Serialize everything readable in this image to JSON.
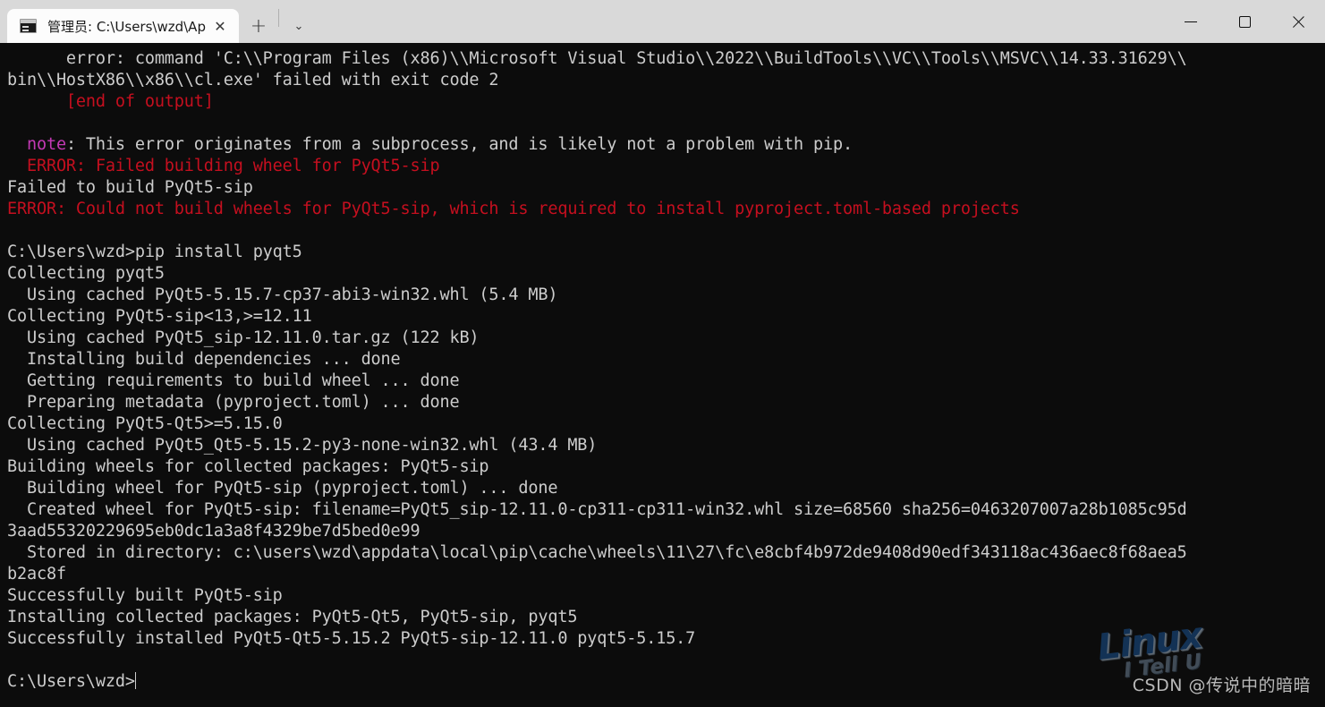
{
  "window": {
    "tab": {
      "title": "管理员: C:\\Users\\wzd\\AppDat",
      "icon": "console-icon",
      "close_label": "✕"
    },
    "new_tab_label": "+",
    "tab_menu_label": "⌄",
    "controls": {
      "minimize_label": "Minimize",
      "maximize_label": "Maximize",
      "close_label": "Close"
    }
  },
  "terminal": {
    "background": "#0c0c0c",
    "foreground": "#cccccc",
    "colors": {
      "white": "#cccccc",
      "red": "#c50f1f",
      "bright_red": "#e74856",
      "magenta": "#c239b3"
    },
    "prompt": "C:\\Users\\wzd>",
    "cursor": "|",
    "lines": [
      {
        "segments": [
          {
            "text": "      error: command 'C:\\\\Program Files (x86)\\\\Microsoft Visual Studio\\\\2022\\\\BuildTools\\\\VC\\\\Tools\\\\MSVC\\\\14.33.31629\\\\",
            "color": "white"
          }
        ]
      },
      {
        "segments": [
          {
            "text": "bin\\\\HostX86\\\\x86\\\\cl.exe' failed with exit code 2",
            "color": "white"
          }
        ]
      },
      {
        "segments": [
          {
            "text": "      [end of output]",
            "color": "red"
          }
        ]
      },
      {
        "segments": [
          {
            "text": "",
            "color": "white"
          }
        ]
      },
      {
        "segments": [
          {
            "text": "  note",
            "color": "magenta"
          },
          {
            "text": ": This error originates from a subprocess, and is likely not a problem with pip.",
            "color": "white"
          }
        ]
      },
      {
        "segments": [
          {
            "text": "  ERROR: Failed building wheel for PyQt5-sip",
            "color": "red"
          }
        ]
      },
      {
        "segments": [
          {
            "text": "Failed to build PyQt5-sip",
            "color": "white"
          }
        ]
      },
      {
        "segments": [
          {
            "text": "ERROR: Could not build wheels for PyQt5-sip, which is required to install pyproject.toml-based projects",
            "color": "red"
          }
        ]
      },
      {
        "segments": [
          {
            "text": "",
            "color": "white"
          }
        ]
      },
      {
        "segments": [
          {
            "text": "C:\\Users\\wzd>pip install pyqt5",
            "color": "white"
          }
        ]
      },
      {
        "segments": [
          {
            "text": "Collecting pyqt5",
            "color": "white"
          }
        ]
      },
      {
        "segments": [
          {
            "text": "  Using cached PyQt5-5.15.7-cp37-abi3-win32.whl (5.4 MB)",
            "color": "white"
          }
        ]
      },
      {
        "segments": [
          {
            "text": "Collecting PyQt5-sip<13,>=12.11",
            "color": "white"
          }
        ]
      },
      {
        "segments": [
          {
            "text": "  Using cached PyQt5_sip-12.11.0.tar.gz (122 kB)",
            "color": "white"
          }
        ]
      },
      {
        "segments": [
          {
            "text": "  Installing build dependencies ... done",
            "color": "white"
          }
        ]
      },
      {
        "segments": [
          {
            "text": "  Getting requirements to build wheel ... done",
            "color": "white"
          }
        ]
      },
      {
        "segments": [
          {
            "text": "  Preparing metadata (pyproject.toml) ... done",
            "color": "white"
          }
        ]
      },
      {
        "segments": [
          {
            "text": "Collecting PyQt5-Qt5>=5.15.0",
            "color": "white"
          }
        ]
      },
      {
        "segments": [
          {
            "text": "  Using cached PyQt5_Qt5-5.15.2-py3-none-win32.whl (43.4 MB)",
            "color": "white"
          }
        ]
      },
      {
        "segments": [
          {
            "text": "Building wheels for collected packages: PyQt5-sip",
            "color": "white"
          }
        ]
      },
      {
        "segments": [
          {
            "text": "  Building wheel for PyQt5-sip (pyproject.toml) ... done",
            "color": "white"
          }
        ]
      },
      {
        "segments": [
          {
            "text": "  Created wheel for PyQt5-sip: filename=PyQt5_sip-12.11.0-cp311-cp311-win32.whl size=68560 sha256=0463207007a28b1085c95d",
            "color": "white"
          }
        ]
      },
      {
        "segments": [
          {
            "text": "3aad55320229695eb0dc1a3a8f4329be7d5bed0e99",
            "color": "white"
          }
        ]
      },
      {
        "segments": [
          {
            "text": "  Stored in directory: c:\\users\\wzd\\appdata\\local\\pip\\cache\\wheels\\11\\27\\fc\\e8cbf4b972de9408d90edf343118ac436aec8f68aea5",
            "color": "white"
          }
        ]
      },
      {
        "segments": [
          {
            "text": "b2ac8f",
            "color": "white"
          }
        ]
      },
      {
        "segments": [
          {
            "text": "Successfully built PyQt5-sip",
            "color": "white"
          }
        ]
      },
      {
        "segments": [
          {
            "text": "Installing collected packages: PyQt5-Qt5, PyQt5-sip, pyqt5",
            "color": "white"
          }
        ]
      },
      {
        "segments": [
          {
            "text": "Successfully installed PyQt5-Qt5-5.15.2 PyQt5-sip-12.11.0 pyqt5-5.15.7",
            "color": "white"
          }
        ]
      },
      {
        "segments": [
          {
            "text": "",
            "color": "white"
          }
        ]
      },
      {
        "segments": [
          {
            "text": "C:\\Users\\wzd>",
            "color": "white",
            "cursor": true
          }
        ]
      }
    ]
  },
  "watermarks": {
    "linux_logo": {
      "line1": "Linux",
      "line2": "I Tell U",
      "color": "#14365c"
    },
    "csdn": "CSDN @传说中的暗暗"
  }
}
